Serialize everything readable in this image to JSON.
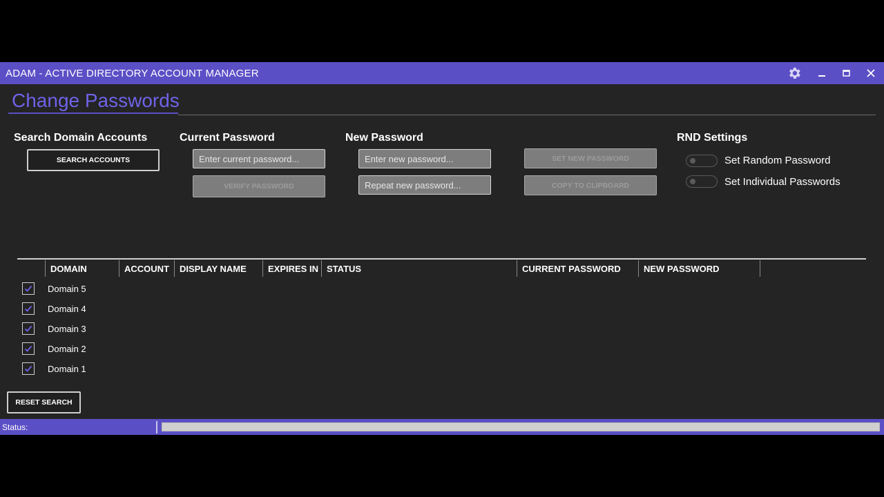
{
  "window": {
    "title": "ADAM - ACTIVE DIRECTORY ACCOUNT MANAGER",
    "accent_color": "#5b4fc6"
  },
  "page": {
    "heading": "Change Passwords"
  },
  "search": {
    "label": "Search Domain Accounts",
    "button": "SEARCH ACCOUNTS"
  },
  "current_password": {
    "label": "Current Password",
    "placeholder": "Enter current password...",
    "verify_button": "VERIFY PASSWORD"
  },
  "new_password": {
    "label": "New Password",
    "placeholder": "Enter new password...",
    "repeat_placeholder": "Repeat new password...",
    "set_button": "SET NEW PASSWORD",
    "copy_button": "COPY TO CLIPBOARD"
  },
  "rnd_settings": {
    "label": "RND Settings",
    "random_toggle": "Set Random Password",
    "individual_toggle": "Set Individual Passwords"
  },
  "table": {
    "columns": [
      "DOMAIN",
      "ACCOUNT",
      "DISPLAY NAME",
      "EXPIRES IN",
      "STATUS",
      "CURRENT PASSWORD",
      "NEW PASSWORD"
    ],
    "rows": [
      {
        "domain": "Domain 5",
        "checked": true
      },
      {
        "domain": "Domain 4",
        "checked": true
      },
      {
        "domain": "Domain 3",
        "checked": true
      },
      {
        "domain": "Domain 2",
        "checked": true
      },
      {
        "domain": "Domain 1",
        "checked": true
      }
    ]
  },
  "actions": {
    "reset_button": "RESET SEARCH"
  },
  "statusbar": {
    "label": "Status:"
  },
  "icons": {
    "settings": "gear-icon",
    "minimize": "minimize-icon",
    "maximize": "maximize-icon",
    "close": "close-icon"
  }
}
